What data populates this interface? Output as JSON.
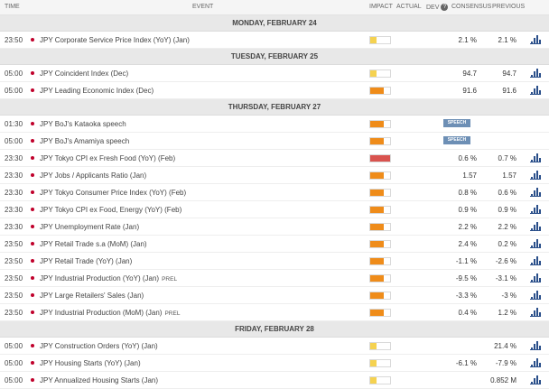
{
  "header": {
    "time": "TIME",
    "event": "EVENT",
    "impact": "IMPACT",
    "actual": "ACTUAL",
    "dev": "DEV",
    "dev_icon": "?",
    "consensus": "CONSENSUS",
    "previous": "PREVIOUS"
  },
  "colors": {
    "orange": "#ef8c1a",
    "yellow": "#f5d250",
    "red": "#d9534f",
    "dot": "#c0002b",
    "chart": "#2a4f8a"
  },
  "days": [
    {
      "label": "MONDAY, FEBRUARY 24",
      "events": [
        {
          "time": "23:50",
          "name": "JPY Corporate Service Price Index (YoY) (Jan)",
          "tag": "",
          "impact": "low",
          "impact_level": 0.33,
          "actual": "",
          "consensus": "2.1 %",
          "previous": "2.1 %",
          "speech": "",
          "chart": true
        }
      ]
    },
    {
      "label": "TUESDAY, FEBRUARY 25",
      "events": [
        {
          "time": "05:00",
          "name": "JPY Coincident Index (Dec)",
          "tag": "",
          "impact": "low",
          "impact_level": 0.33,
          "actual": "",
          "consensus": "94.7",
          "previous": "94.7",
          "speech": "",
          "chart": true
        },
        {
          "time": "05:00",
          "name": "JPY Leading Economic Index (Dec)",
          "tag": "",
          "impact": "medium",
          "impact_level": 0.66,
          "actual": "",
          "consensus": "91.6",
          "previous": "91.6",
          "speech": "",
          "chart": true
        }
      ]
    },
    {
      "label": "THURSDAY, FEBRUARY 27",
      "events": [
        {
          "time": "01:30",
          "name": "JPY BoJ's Kataoka speech",
          "tag": "",
          "impact": "medium",
          "impact_level": 0.66,
          "actual": "",
          "consensus": "",
          "previous": "",
          "speech": "SPEECH",
          "chart": false
        },
        {
          "time": "05:00",
          "name": "JPY BoJ's Amamiya speech",
          "tag": "",
          "impact": "medium",
          "impact_level": 0.66,
          "actual": "",
          "consensus": "",
          "previous": "",
          "speech": "SPEECH",
          "chart": false
        },
        {
          "time": "23:30",
          "name": "JPY Tokyo CPI ex Fresh Food (YoY) (Feb)",
          "tag": "",
          "impact": "high",
          "impact_level": 1.0,
          "actual": "",
          "consensus": "0.6 %",
          "previous": "0.7 %",
          "speech": "",
          "chart": true
        },
        {
          "time": "23:30",
          "name": "JPY Jobs / Applicants Ratio (Jan)",
          "tag": "",
          "impact": "medium",
          "impact_level": 0.66,
          "actual": "",
          "consensus": "1.57",
          "previous": "1.57",
          "speech": "",
          "chart": true
        },
        {
          "time": "23:30",
          "name": "JPY Tokyo Consumer Price Index (YoY) (Feb)",
          "tag": "",
          "impact": "medium",
          "impact_level": 0.66,
          "actual": "",
          "consensus": "0.8 %",
          "previous": "0.6 %",
          "speech": "",
          "chart": true
        },
        {
          "time": "23:30",
          "name": "JPY Tokyo CPI ex Food, Energy (YoY) (Feb)",
          "tag": "",
          "impact": "medium",
          "impact_level": 0.66,
          "actual": "",
          "consensus": "0.9 %",
          "previous": "0.9 %",
          "speech": "",
          "chart": true
        },
        {
          "time": "23:30",
          "name": "JPY Unemployment Rate (Jan)",
          "tag": "",
          "impact": "medium",
          "impact_level": 0.66,
          "actual": "",
          "consensus": "2.2 %",
          "previous": "2.2 %",
          "speech": "",
          "chart": true
        },
        {
          "time": "23:50",
          "name": "JPY Retail Trade s.a (MoM) (Jan)",
          "tag": "",
          "impact": "medium",
          "impact_level": 0.66,
          "actual": "",
          "consensus": "2.4 %",
          "previous": "0.2 %",
          "speech": "",
          "chart": true
        },
        {
          "time": "23:50",
          "name": "JPY Retail Trade (YoY) (Jan)",
          "tag": "",
          "impact": "medium",
          "impact_level": 0.66,
          "actual": "",
          "consensus": "-1.1 %",
          "previous": "-2.6 %",
          "speech": "",
          "chart": true
        },
        {
          "time": "23:50",
          "name": "JPY Industrial Production (YoY) (Jan)",
          "tag": "PREL",
          "impact": "medium",
          "impact_level": 0.66,
          "actual": "",
          "consensus": "-9.5 %",
          "previous": "-3.1 %",
          "speech": "",
          "chart": true
        },
        {
          "time": "23:50",
          "name": "JPY Large Retailers' Sales (Jan)",
          "tag": "",
          "impact": "medium",
          "impact_level": 0.66,
          "actual": "",
          "consensus": "-3.3 %",
          "previous": "-3 %",
          "speech": "",
          "chart": true
        },
        {
          "time": "23:50",
          "name": "JPY Industrial Production (MoM) (Jan)",
          "tag": "PREL",
          "impact": "medium",
          "impact_level": 0.66,
          "actual": "",
          "consensus": "0.4 %",
          "previous": "1.2 %",
          "speech": "",
          "chart": true
        }
      ]
    },
    {
      "label": "FRIDAY, FEBRUARY 28",
      "events": [
        {
          "time": "05:00",
          "name": "JPY Construction Orders (YoY) (Jan)",
          "tag": "",
          "impact": "low",
          "impact_level": 0.33,
          "actual": "",
          "consensus": "",
          "previous": "21.4 %",
          "speech": "",
          "chart": true
        },
        {
          "time": "05:00",
          "name": "JPY Housing Starts (YoY) (Jan)",
          "tag": "",
          "impact": "low",
          "impact_level": 0.33,
          "actual": "",
          "consensus": "-6.1 %",
          "previous": "-7.9 %",
          "speech": "",
          "chart": true
        },
        {
          "time": "05:00",
          "name": "JPY Annualized Housing Starts (Jan)",
          "tag": "",
          "impact": "low",
          "impact_level": 0.33,
          "actual": "",
          "consensus": "",
          "previous": "0.852 M",
          "speech": "",
          "chart": true
        }
      ]
    }
  ]
}
